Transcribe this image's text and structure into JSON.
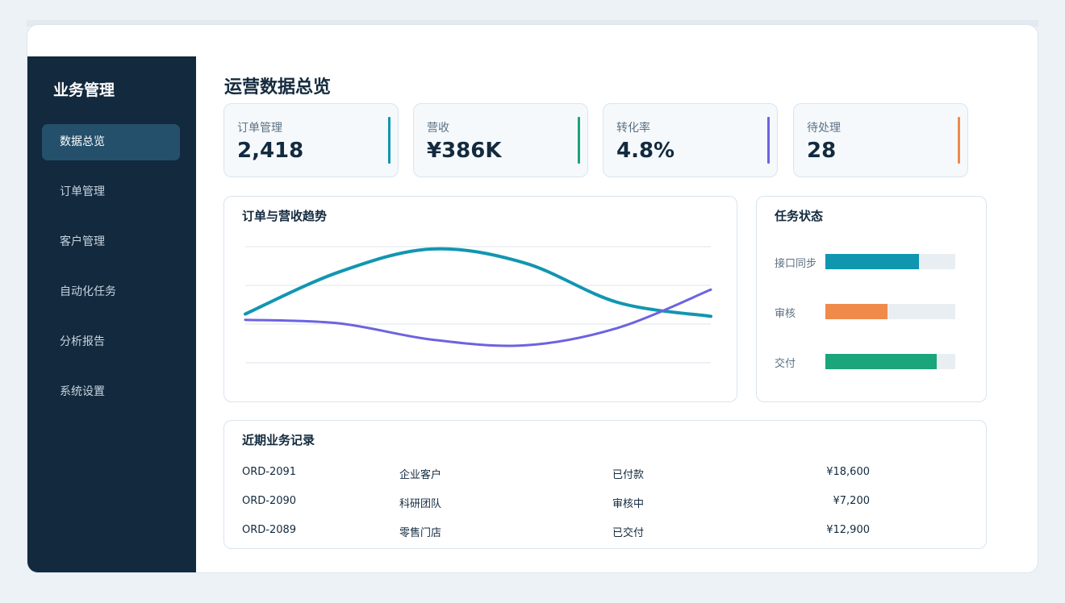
{
  "sidebar": {
    "title": "业务管理",
    "items": [
      {
        "label": "数据总览",
        "active": true
      },
      {
        "label": "订单管理",
        "active": false
      },
      {
        "label": "客户管理",
        "active": false
      },
      {
        "label": "自动化任务",
        "active": false
      },
      {
        "label": "分析报告",
        "active": false
      },
      {
        "label": "系统设置",
        "active": false
      }
    ]
  },
  "page": {
    "title": "运营数据总览"
  },
  "stats": [
    {
      "label": "订单管理",
      "value": "2,418",
      "color": "#1196b0"
    },
    {
      "label": "营收",
      "value": "¥386K",
      "color": "#1aa57a"
    },
    {
      "label": "转化率",
      "value": "4.8%",
      "color": "#6c63e0"
    },
    {
      "label": "待处理",
      "value": "28",
      "color": "#f08a4b"
    }
  ],
  "trend": {
    "title": "订单与营收趋势",
    "series": [
      {
        "color": "#1196b0",
        "values": [
          0.42,
          0.78,
          0.98,
          0.86,
          0.52,
          0.4
        ]
      },
      {
        "color": "#6c63e0",
        "values": [
          0.37,
          0.34,
          0.2,
          0.15,
          0.3,
          0.63
        ]
      }
    ]
  },
  "tasks": {
    "title": "任务状态",
    "items": [
      {
        "label": "接口同步",
        "progress": 0.72,
        "color": "#1196b0"
      },
      {
        "label": "审核",
        "progress": 0.48,
        "color": "#f08a4b"
      },
      {
        "label": "交付",
        "progress": 0.86,
        "color": "#1aa57a"
      }
    ]
  },
  "records": {
    "title": "近期业务记录",
    "rows": [
      {
        "id": "ORD-2091",
        "customer": "企业客户",
        "status": "已付款",
        "amount": "¥18,600"
      },
      {
        "id": "ORD-2090",
        "customer": "科研团队",
        "status": "审核中",
        "amount": "¥7,200"
      },
      {
        "id": "ORD-2089",
        "customer": "零售门店",
        "status": "已交付",
        "amount": "¥12,900"
      }
    ]
  }
}
